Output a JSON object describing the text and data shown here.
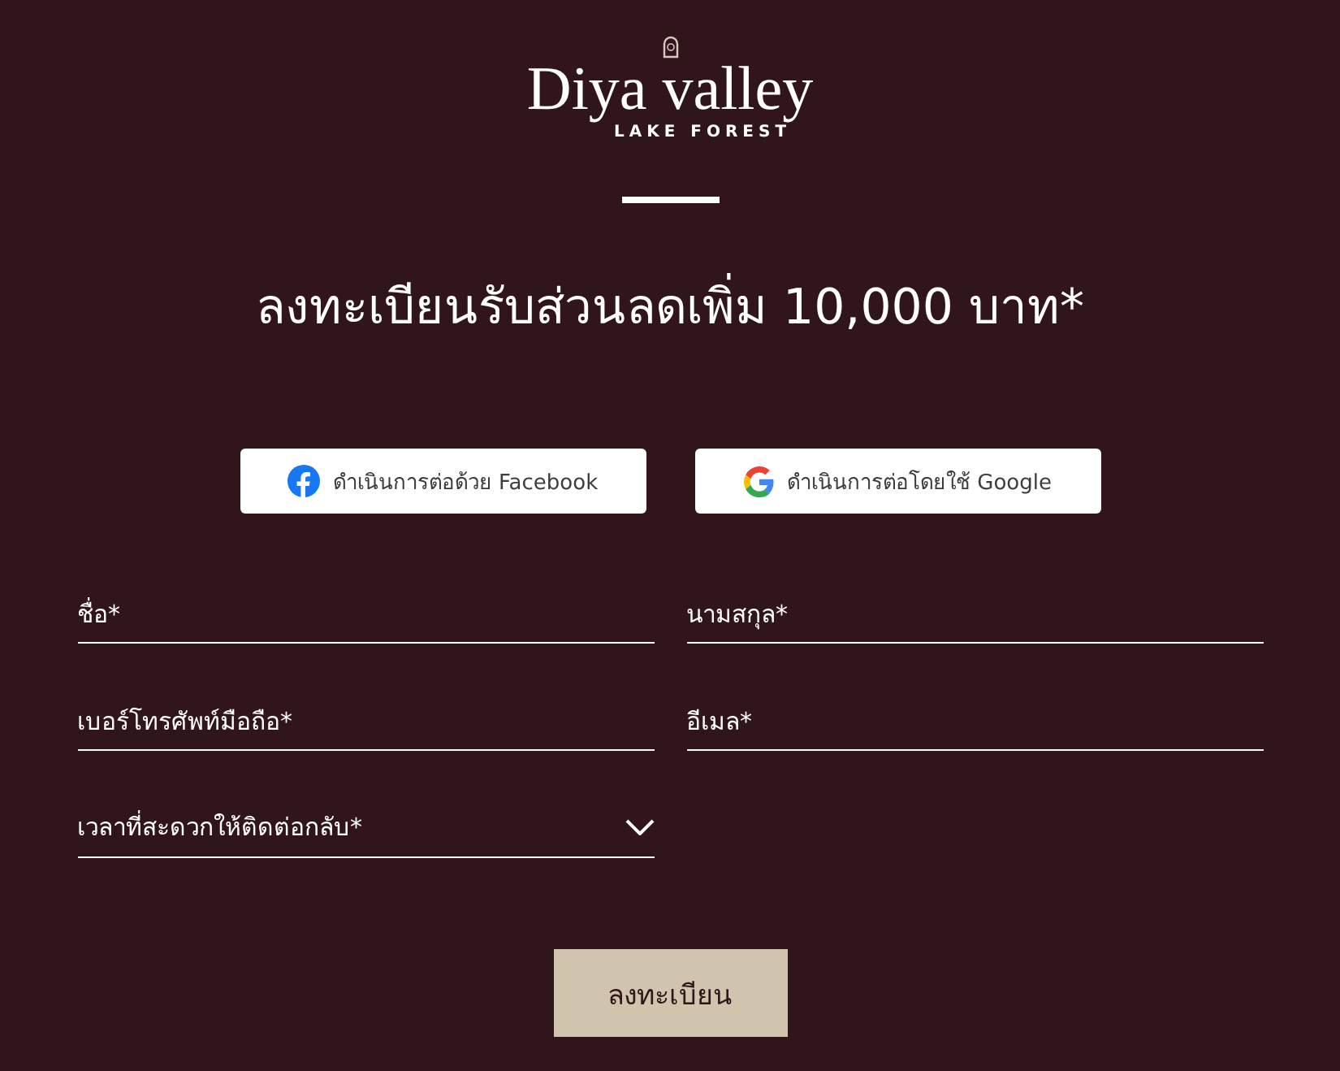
{
  "logo": {
    "name": "Diya valley",
    "tagline": "LAKE FOREST"
  },
  "heading": "ลงทะเบียนรับส่วนลดเพิ่ม 10,000 บาท*",
  "social_buttons": [
    {
      "kind": "facebook",
      "label": "ดำเนินการต่อด้วย Facebook"
    },
    {
      "kind": "google",
      "label": "ดำเนินการต่อโดยใช้ Google"
    }
  ],
  "fields": [
    {
      "kind": "text",
      "placeholder": "ชื่อ*"
    },
    {
      "kind": "text",
      "placeholder": "นามสกุล*"
    },
    {
      "kind": "text",
      "placeholder": "เบอร์โทรศัพท์มือถือ*"
    },
    {
      "kind": "text",
      "placeholder": "อีเมล*"
    },
    {
      "kind": "select",
      "placeholder": "เวลาที่สะดวกให้ติดต่อกลับ*"
    }
  ],
  "submit": "ลงทะเบียน"
}
